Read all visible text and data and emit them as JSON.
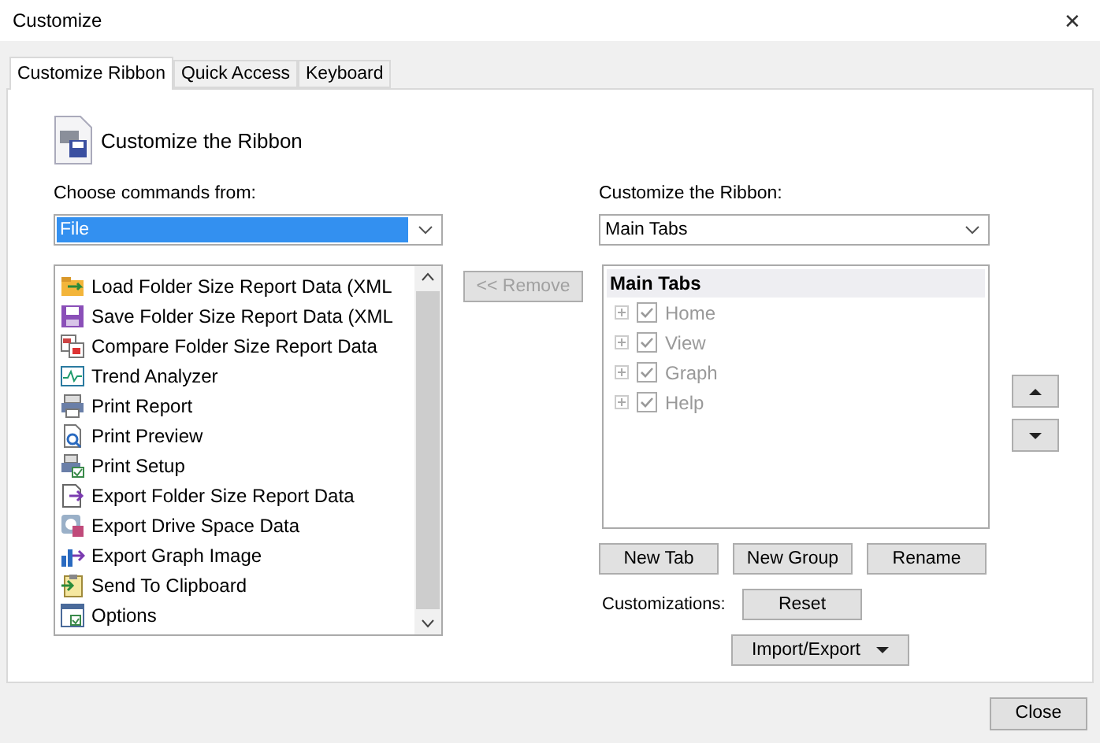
{
  "window": {
    "title": "Customize",
    "close": "✕"
  },
  "tabs": [
    {
      "label": "Customize Ribbon",
      "selected": true
    },
    {
      "label": "Quick Access",
      "selected": false
    },
    {
      "label": "Keyboard",
      "selected": false
    }
  ],
  "heading": "Customize the Ribbon",
  "commands": {
    "label": "Choose commands from:",
    "value": "File",
    "focused": true,
    "items": [
      "Load Folder Size Report Data (XML",
      "Save Folder Size Report Data (XML",
      "Compare Folder Size Report Data",
      "Trend Analyzer",
      "Print Report",
      "Print Preview",
      "Print Setup",
      "Export Folder Size Report Data",
      "Export Drive Space Data",
      "Export Graph Image",
      "Send To Clipboard",
      "Options"
    ]
  },
  "remove_button": {
    "label": "<< Remove",
    "disabled": true
  },
  "ribbon": {
    "label": "Customize the Ribbon:",
    "value": "Main Tabs",
    "header": "Main Tabs",
    "tree": [
      {
        "label": "Home",
        "expanded": false,
        "checked": true
      },
      {
        "label": "View",
        "expanded": false,
        "checked": true
      },
      {
        "label": "Graph",
        "expanded": false,
        "checked": true
      },
      {
        "label": "Help",
        "expanded": false,
        "checked": true
      }
    ]
  },
  "tab_buttons": [
    "New Tab",
    "New Group",
    "Rename"
  ],
  "customizations": {
    "label": "Customizations:",
    "reset": "Reset",
    "import_export": "Import/Export"
  },
  "close_button": "Close"
}
